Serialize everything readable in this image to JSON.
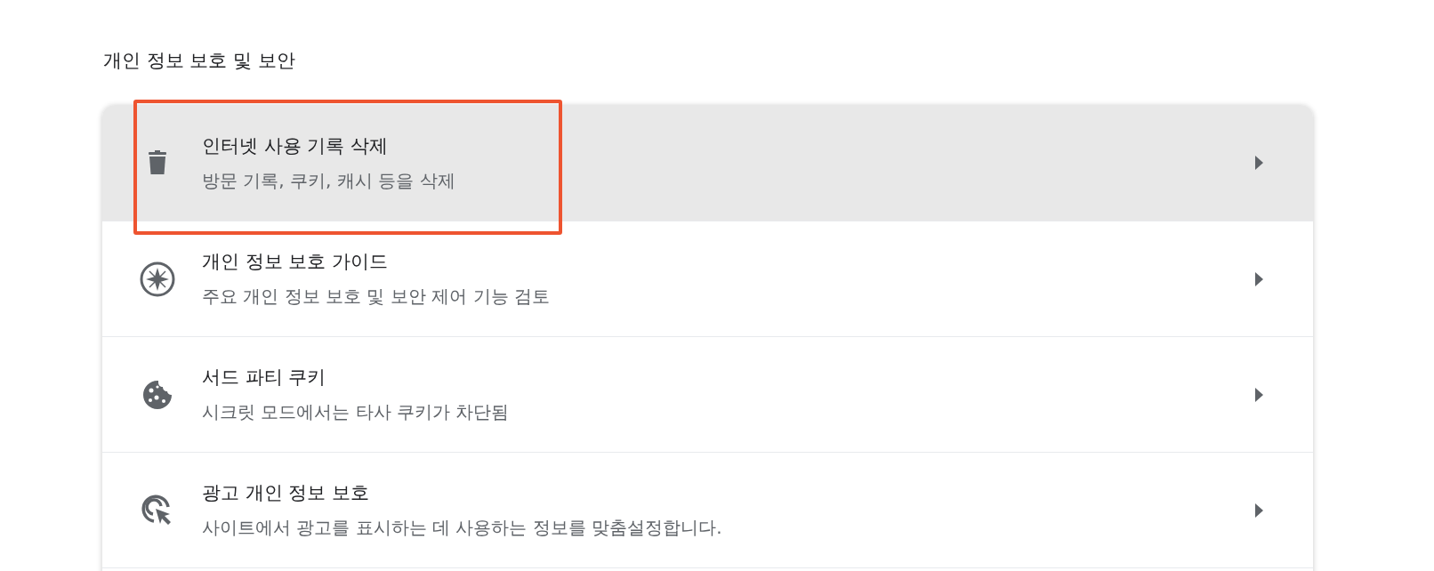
{
  "section_title": "개인 정보 보호 및 보안",
  "items": [
    {
      "kind": "trash",
      "title": "인터넷 사용 기록 삭제",
      "subtitle": "방문 기록, 쿠키, 캐시 등을 삭제",
      "selected": true
    },
    {
      "kind": "compass",
      "title": "개인 정보 보호 가이드",
      "subtitle": "주요 개인 정보 보호 및 보안 제어 기능 검토",
      "selected": false
    },
    {
      "kind": "cookie",
      "title": "서드 파티 쿠키",
      "subtitle": "시크릿 모드에서는 타사 쿠키가 차단됨",
      "selected": false
    },
    {
      "kind": "ad-cursor",
      "title": "광고 개인 정보 보호",
      "subtitle": "사이트에서 광고를 표시하는 데 사용하는 정보를 맞춤설정합니다.",
      "selected": false
    }
  ]
}
